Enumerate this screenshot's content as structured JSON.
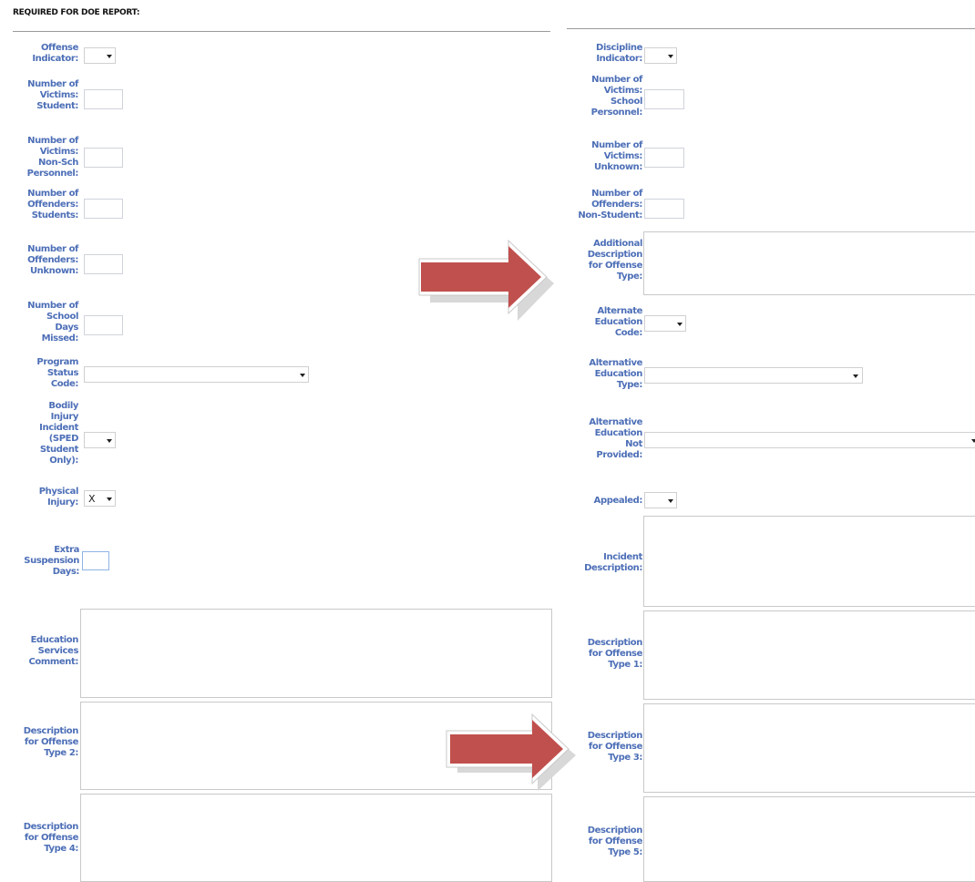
{
  "header": {
    "title": "REQUIRED FOR DOE REPORT:"
  },
  "left": {
    "offense_indicator": {
      "label": "Offense\nIndicator:",
      "value": ""
    },
    "victims_student": {
      "label": "Number of\nVictims:\nStudent:"
    },
    "victims_nonsch": {
      "label": "Number of\nVictims:\nNon-Sch\nPersonnel:"
    },
    "offenders_students": {
      "label": "Number of\nOffenders:\nStudents:"
    },
    "offenders_unknown": {
      "label": "Number of\nOffenders:\nUnknown:"
    },
    "days_missed": {
      "label": "Number of\nSchool\nDays\nMissed:"
    },
    "program_status": {
      "label": "Program\nStatus\nCode:",
      "value": ""
    },
    "bodily_injury": {
      "label": "Bodily\nInjury\nIncident\n(SPED\nStudent\nOnly):",
      "value": ""
    },
    "physical_injury": {
      "label": "Physical\nInjury:",
      "value": "X"
    },
    "extra_suspension": {
      "label": "Extra\nSuspension\nDays:"
    },
    "education_services": {
      "label": "Education\nServices\nComment:"
    },
    "desc_type2": {
      "label": "Description\nfor Offense\nType 2:"
    },
    "desc_type4": {
      "label": "Description\nfor Offense\nType 4:"
    }
  },
  "right": {
    "discipline_indicator": {
      "label": "Discipline\nIndicator:",
      "value": ""
    },
    "victims_school": {
      "label": "Number of\nVictims:\nSchool\nPersonnel:"
    },
    "victims_unknown": {
      "label": "Number of\nVictims:\nUnknown:"
    },
    "offenders_nonstudent": {
      "label": "Number of\nOffenders:\nNon-Student:"
    },
    "additional_desc": {
      "label": "Additional\nDescription\nfor Offense\nType:"
    },
    "alt_ed_code": {
      "label": "Alternate\nEducation\nCode:",
      "value": ""
    },
    "alt_ed_type": {
      "label": "Alternative\nEducation\nType:",
      "value": ""
    },
    "alt_ed_not_provided": {
      "label": "Alternative\nEducation\nNot\nProvided:",
      "value": ""
    },
    "appealed": {
      "label": "Appealed:",
      "value": ""
    },
    "incident_desc": {
      "label": "Incident\nDescription:"
    },
    "desc_type1": {
      "label": "Description\nfor Offense\nType 1:"
    },
    "desc_type3": {
      "label": "Description\nfor Offense\nType 3:"
    },
    "desc_type5": {
      "label": "Description\nfor Offense\nType 5:"
    }
  },
  "annotations": {
    "arrow_color": "#c0504d"
  }
}
